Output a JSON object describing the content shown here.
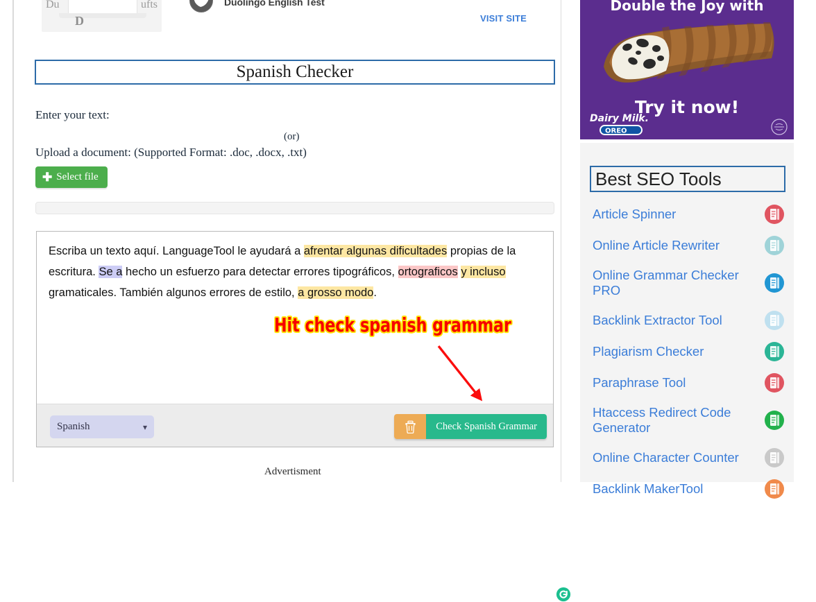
{
  "top_ad": {
    "advertiser": "Duolingo English Test",
    "cta": "VISIT SITE",
    "thumb_left": "Du",
    "thumb_right": "ufts",
    "thumb_bottom": "D"
  },
  "page": {
    "title": "Spanish Checker",
    "label_enter_text": "Enter your text:",
    "label_or": "(or)",
    "label_upload": "Upload a document: (Supported Format: .doc, .docx, .txt)",
    "select_file_button": "Select file",
    "select_file_icon": "plus-icon",
    "advertisement_label": "Advertisment"
  },
  "editor": {
    "segments": [
      {
        "text": "Escriba un texto aquí. LanguageTool le ayudará a ",
        "hl": "none"
      },
      {
        "text": "afrentar algunas dificultades",
        "hl": "yellow"
      },
      {
        "text": " propias de la escritura. ",
        "hl": "none"
      },
      {
        "text": "Se a",
        "hl": "violet"
      },
      {
        "text": " hecho un esfuerzo para detectar errores tipográficos, ",
        "hl": "none"
      },
      {
        "text": "ortograficos",
        "hl": "pink"
      },
      {
        "text": " ",
        "hl": "none"
      },
      {
        "text": "y incluso",
        "hl": "yellow"
      },
      {
        "text": " gramaticales. También algunos errores de estilo, ",
        "hl": "none"
      },
      {
        "text": "a grosso modo",
        "hl": "yellow"
      },
      {
        "text": ".",
        "hl": "none"
      }
    ],
    "plain_text": "Escriba un texto aquí. LanguageTool le ayudará a afrentar algunas dificultades propias de la escritura. Se a hecho un esfuerzo para detectar errores tipográficos, ortograficos y incluso gramaticales. También algunos errores de estilo, a grosso modo.",
    "refresh_icon": "languagetool-refresh-icon",
    "language_selected": "Spanish",
    "language_chevron": "⌄",
    "clear_icon": "trash-icon",
    "check_button": "Check Spanish Grammar"
  },
  "annotation": {
    "text": "Hit check spanish grammar",
    "text_color": "#f60000",
    "outline_color": "#ffe400",
    "arrow_color": "#fb0d0d"
  },
  "promo": {
    "headline": "Double the Joy with",
    "cta": "Try it now!",
    "brand_line1": "Dairy Milk.",
    "brand_line2": "OREO",
    "bg_color": "#5b2d8e",
    "halal_badge": "halal-badge-icon"
  },
  "sidebar": {
    "title": "Best SEO Tools",
    "items": [
      {
        "label": "Article Spinner",
        "icon": "article-spinner-icon",
        "icon_color": "#e05561",
        "two_line": false
      },
      {
        "label": "Online Article Rewriter",
        "icon": "article-rewriter-icon",
        "icon_color": "#9fd3d8",
        "two_line": false
      },
      {
        "label": "Online Grammar Checker PRO",
        "icon": "grammar-checker-icon",
        "icon_color": "#2196d3",
        "two_line": true
      },
      {
        "label": "Backlink Extractor Tool",
        "icon": "backlink-extractor-icon",
        "icon_color": "#bfe0ef",
        "two_line": false
      },
      {
        "label": "Plagiarism Checker",
        "icon": "plagiarism-checker-icon",
        "icon_color": "#2bb596",
        "two_line": false
      },
      {
        "label": "Paraphrase Tool",
        "icon": "paraphrase-tool-icon",
        "icon_color": "#e05561",
        "two_line": false
      },
      {
        "label": "Htaccess Redirect Code Generator",
        "icon": "redirect-generator-icon",
        "icon_color": "#22b14c",
        "two_line": true
      },
      {
        "label": "Online Character Counter",
        "icon": "character-counter-icon",
        "icon_color": "#c9c9c9",
        "two_line": false
      },
      {
        "label": "Backlink MakerTool",
        "icon": "backlink-maker-icon",
        "icon_color": "#f08a4b",
        "two_line": false
      }
    ]
  },
  "colors": {
    "accent_blue": "#2c6ba8",
    "link_blue": "#3b7dd8",
    "green_button": "#4cae4c",
    "teal_button": "#28b98c",
    "orange_button": "#edab55",
    "highlight_yellow": "#fde7a3",
    "highlight_pink": "#fbc7c7",
    "highlight_violet": "#ccccf5"
  }
}
